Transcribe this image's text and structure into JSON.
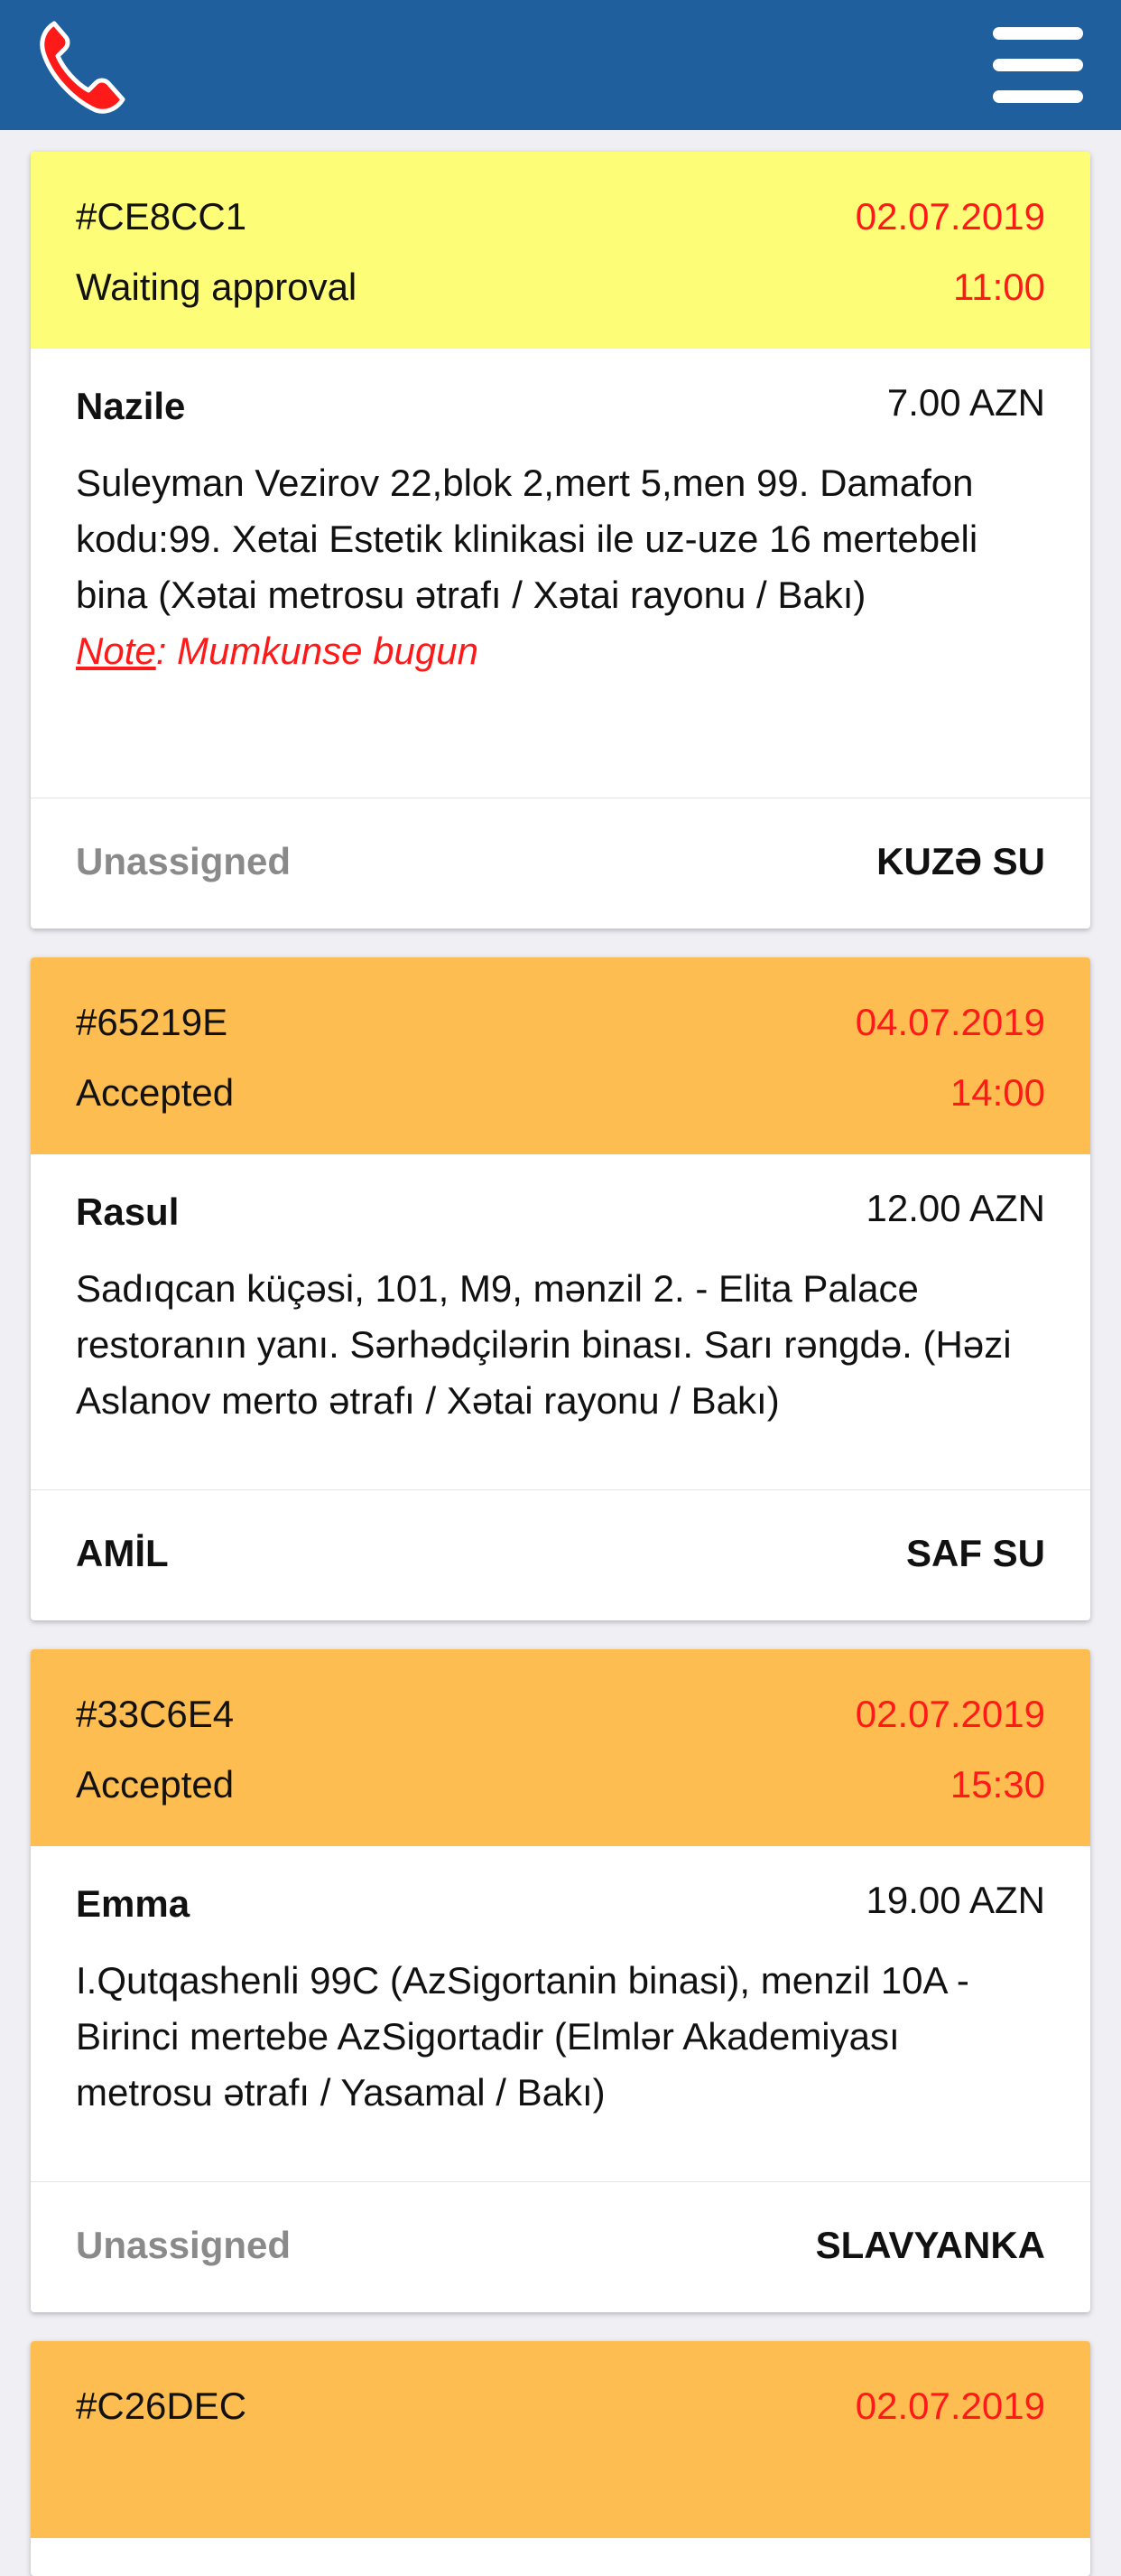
{
  "header": {
    "phone_icon": "phone-icon",
    "menu_icon": "hamburger-menu-icon",
    "bar_color": "#1f5f9e"
  },
  "colors": {
    "waiting": "#fdfd77",
    "accepted": "#fdbd50",
    "datetime": "#ff1a1a",
    "unassigned": "#8a8a8a"
  },
  "orders": [
    {
      "code": "#CE8CC1",
      "status": "Waiting approval",
      "date": "02.07.2019",
      "time": "11:00",
      "customer": "Nazile",
      "price": "7.00 AZN",
      "address": "Suleyman Vezirov 22,blok 2,mert 5,men 99. Damafon kodu:99. Xetai Estetik klinikasi ile uz-uze 16 mertebeli bina (Xətai metrosu ətrafı / Xətai rayonu / Bakı)",
      "note_label": "Note",
      "note_text": ": Mumkunse bugun",
      "courier": "Unassigned",
      "product": "KUZƏ SU"
    },
    {
      "code": "#65219E",
      "status": "Accepted",
      "date": "04.07.2019",
      "time": "14:00",
      "customer": "Rasul",
      "price": "12.00 AZN",
      "address": "Sadıqcan küçəsi, 101, M9, mənzil 2. - Elita Palace restoranın yanı. Sərhədçilərin binası. Sarı rəngdə. (Həzi Aslanov merto ətrafı / Xətai rayonu / Bakı)",
      "courier": "AMİL",
      "product": "SAF SU"
    },
    {
      "code": "#33C6E4",
      "status": "Accepted",
      "date": "02.07.2019",
      "time": "15:30",
      "customer": "Emma",
      "price": "19.00 AZN",
      "address": "I.Qutqashenli 99C (AzSigortanin binasi), menzil 10A - Birinci mertebe AzSigortadir (Elmlər Akademiyası metrosu ətrafı / Yasamal / Bakı)",
      "courier": "Unassigned",
      "product": "SLAVYANKA"
    },
    {
      "code": "#C26DEC",
      "date": "02.07.2019"
    }
  ]
}
